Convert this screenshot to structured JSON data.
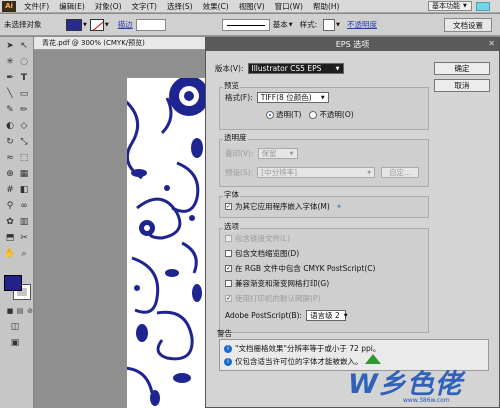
{
  "app": {
    "logo": "Ai"
  },
  "menubar": {
    "items": [
      "文件(F)",
      "编辑(E)",
      "对象(O)",
      "文字(T)",
      "选择(S)",
      "效果(C)",
      "视图(V)",
      "窗口(W)",
      "帮助(H)"
    ],
    "workspace_label": "基本功能"
  },
  "control_bar": {
    "selection_label": "未选择对象",
    "stroke_link": "描边",
    "line_style": "基本",
    "style_label": "样式:",
    "opacity_link": "不透明度",
    "doc_settings": "文档设置"
  },
  "document": {
    "tab_title": "青花.pdf @ 300% (CMYK/预览)"
  },
  "colors": {
    "fill": "#25218a",
    "artwork": "#1f2590",
    "accent_blue": "#1f56b8"
  },
  "dialog": {
    "title": "EPS 选项",
    "version_label": "版本(V):",
    "version_value": "Illustrator CS5 EPS",
    "ok": "确定",
    "cancel": "取消",
    "preview_group": "预览",
    "format_label": "格式(F):",
    "format_value": "TIFF(8 位颜色)",
    "transparent_label": "透明(T)",
    "opaque_label": "不透明(O)",
    "transparency_group": "透明度",
    "overprint_label": "叠印(V):",
    "overprint_value": "保留",
    "preset_label": "预设(S):",
    "preset_value": "[中分辨率]",
    "custom_btn": "自定...",
    "fonts_group": "字体",
    "embed_fonts": "为其它应用程序嵌入字体(M)",
    "options_group": "选项",
    "opt_linked": "包含链接文件(L)",
    "opt_thumbnails": "包含文档缩览图(D)",
    "opt_cmyk": "在 RGB 文件中包含 CMYK PostScript(C)",
    "opt_compat_gradient": "兼容渐变和渐变网格打印(G)",
    "opt_printer_res": "使用打印机的默认网屏(P)",
    "ps_label": "Adobe PostScript(B):",
    "ps_value": "语言级 2",
    "warnings_group": "警告",
    "warnings": [
      "\"文档栅格效果\"分辨率等于或小于 72 ppi。",
      "仅包含适当许可位的字体才能被嵌入。"
    ]
  },
  "watermark": {
    "brand": "W乡色佬",
    "url": "www.386w.com"
  }
}
